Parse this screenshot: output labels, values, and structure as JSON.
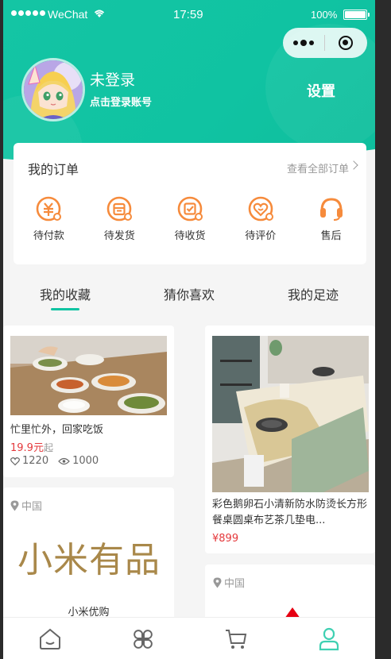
{
  "status_bar": {
    "carrier": "WeChat",
    "time": "17:59",
    "battery": "100%"
  },
  "profile": {
    "name": "未登录",
    "hint": "点击登录账号",
    "settings": "设置"
  },
  "orders": {
    "title": "我的订单",
    "view_all": "查看全部订单",
    "items": [
      {
        "label": "待付款",
        "icon": "payment-pending-icon"
      },
      {
        "label": "待发货",
        "icon": "to-ship-icon"
      },
      {
        "label": "待收货",
        "icon": "to-receive-icon"
      },
      {
        "label": "待评价",
        "icon": "to-review-icon"
      },
      {
        "label": "售后",
        "icon": "after-sale-headset-icon"
      }
    ]
  },
  "tabs": [
    "我的收藏",
    "猜你喜欢",
    "我的足迹"
  ],
  "feed": {
    "card1": {
      "title": "忙里忙外，回家吃饭",
      "price": "19.9元",
      "price_suffix": "起",
      "likes": "1220",
      "views": "1000"
    },
    "card2": {
      "title": "彩色鹅卵石小清新防水防烫长方形餐桌圆桌布艺茶几垫电...",
      "price": "¥899"
    },
    "card3": {
      "location": "中国",
      "brand_logo": "小米有品",
      "name": "小米优购"
    },
    "card4": {
      "location": "中国"
    }
  },
  "colors": {
    "accent": "#10c3a2",
    "order_icon": "#f68b3c",
    "price": "#e4393c"
  }
}
